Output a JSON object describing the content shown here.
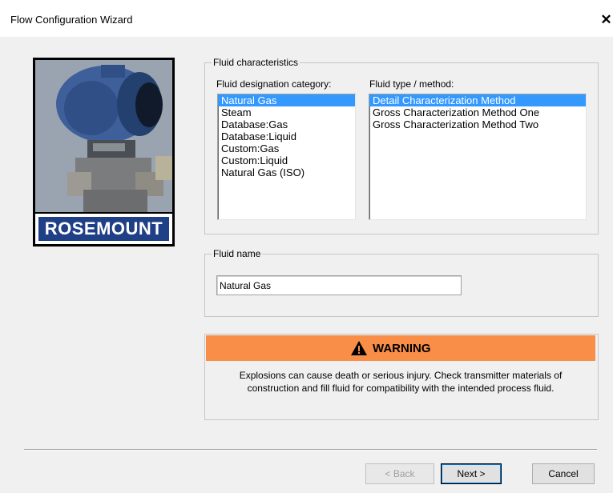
{
  "window": {
    "title": "Flow Configuration Wizard",
    "close_glyph": "✕"
  },
  "branding": {
    "logo_text": "ROSEMOUNT",
    "brand_color": "#1f3f86"
  },
  "fluid_characteristics": {
    "legend": "Fluid characteristics",
    "category_label": "Fluid designation category:",
    "categories": [
      "Natural Gas",
      "Steam",
      "Database:Gas",
      "Database:Liquid",
      "Custom:Gas",
      "Custom:Liquid",
      "Natural Gas (ISO)"
    ],
    "selected_category": "Natural Gas",
    "type_label": "Fluid type / method:",
    "types": [
      "Detail Characterization Method",
      "Gross Characterization Method One",
      "Gross Characterization Method Two"
    ],
    "selected_type": "Detail Characterization Method"
  },
  "fluid_name": {
    "legend": "Fluid name",
    "value": "Natural Gas"
  },
  "warning": {
    "title": "WARNING",
    "accent_color": "#f98e48",
    "message": "Explosions can cause death or serious injury. Check transmitter materials of construction and fill fluid for compatibility with the intended process fluid."
  },
  "buttons": {
    "back": "< Back",
    "next": "Next >",
    "cancel": "Cancel"
  }
}
